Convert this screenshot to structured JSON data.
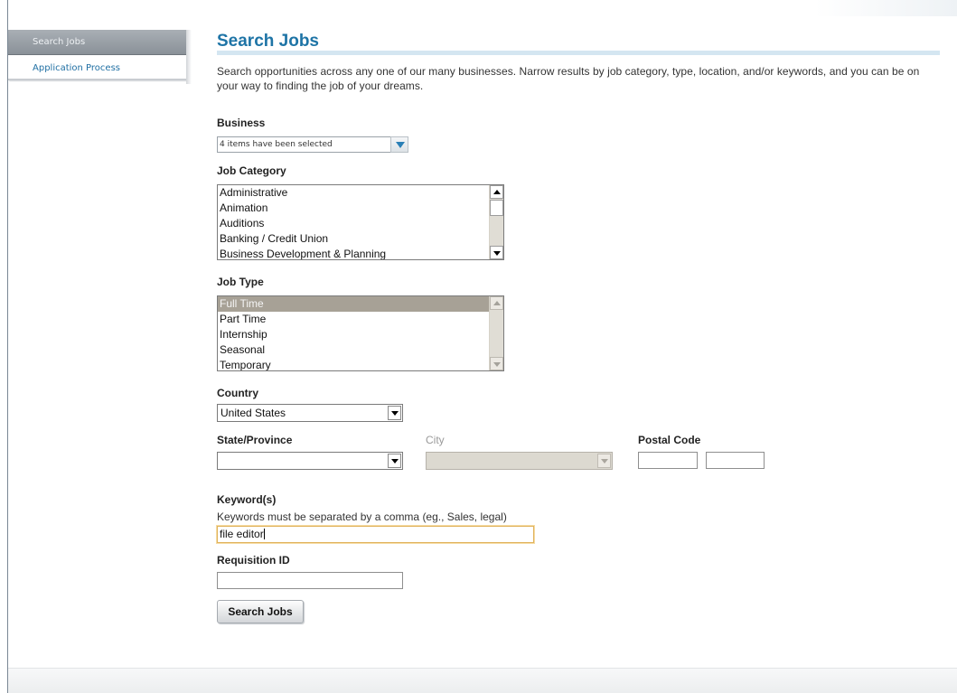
{
  "sidebar": {
    "items": [
      {
        "label": "Search Jobs",
        "active": true
      },
      {
        "label": "Application Process",
        "active": false
      }
    ]
  },
  "main": {
    "title": "Search Jobs",
    "intro": "Search opportunities across any one of our many businesses. Narrow results by job category, type, location, and/or keywords, and you can be on your way to finding the job of your dreams."
  },
  "form": {
    "business": {
      "label": "Business",
      "value": "4 items have been selected"
    },
    "job_category": {
      "label": "Job Category",
      "options": [
        "Administrative",
        "Animation",
        "Auditions",
        "Banking / Credit Union",
        "Business Development & Planning"
      ]
    },
    "job_type": {
      "label": "Job Type",
      "options": [
        "Full Time",
        "Part Time",
        "Internship",
        "Seasonal",
        "Temporary"
      ],
      "selected": "Full Time"
    },
    "country": {
      "label": "Country",
      "value": "United States"
    },
    "state": {
      "label": "State/Province",
      "value": ""
    },
    "city": {
      "label": "City",
      "value": ""
    },
    "postal_code": {
      "label": "Postal Code",
      "value_1": "",
      "value_2": ""
    },
    "keywords": {
      "label": "Keyword(s)",
      "hint": "Keywords must be separated by a comma (eg., Sales, legal)",
      "value": "file editor"
    },
    "requisition_id": {
      "label": "Requisition ID",
      "value": ""
    },
    "submit_label": "Search Jobs"
  },
  "colors": {
    "title_blue": "#1e74a6",
    "link_blue": "#1f6fa3",
    "selected_option": "#a7a196",
    "focus_border": "#e0b25b"
  }
}
